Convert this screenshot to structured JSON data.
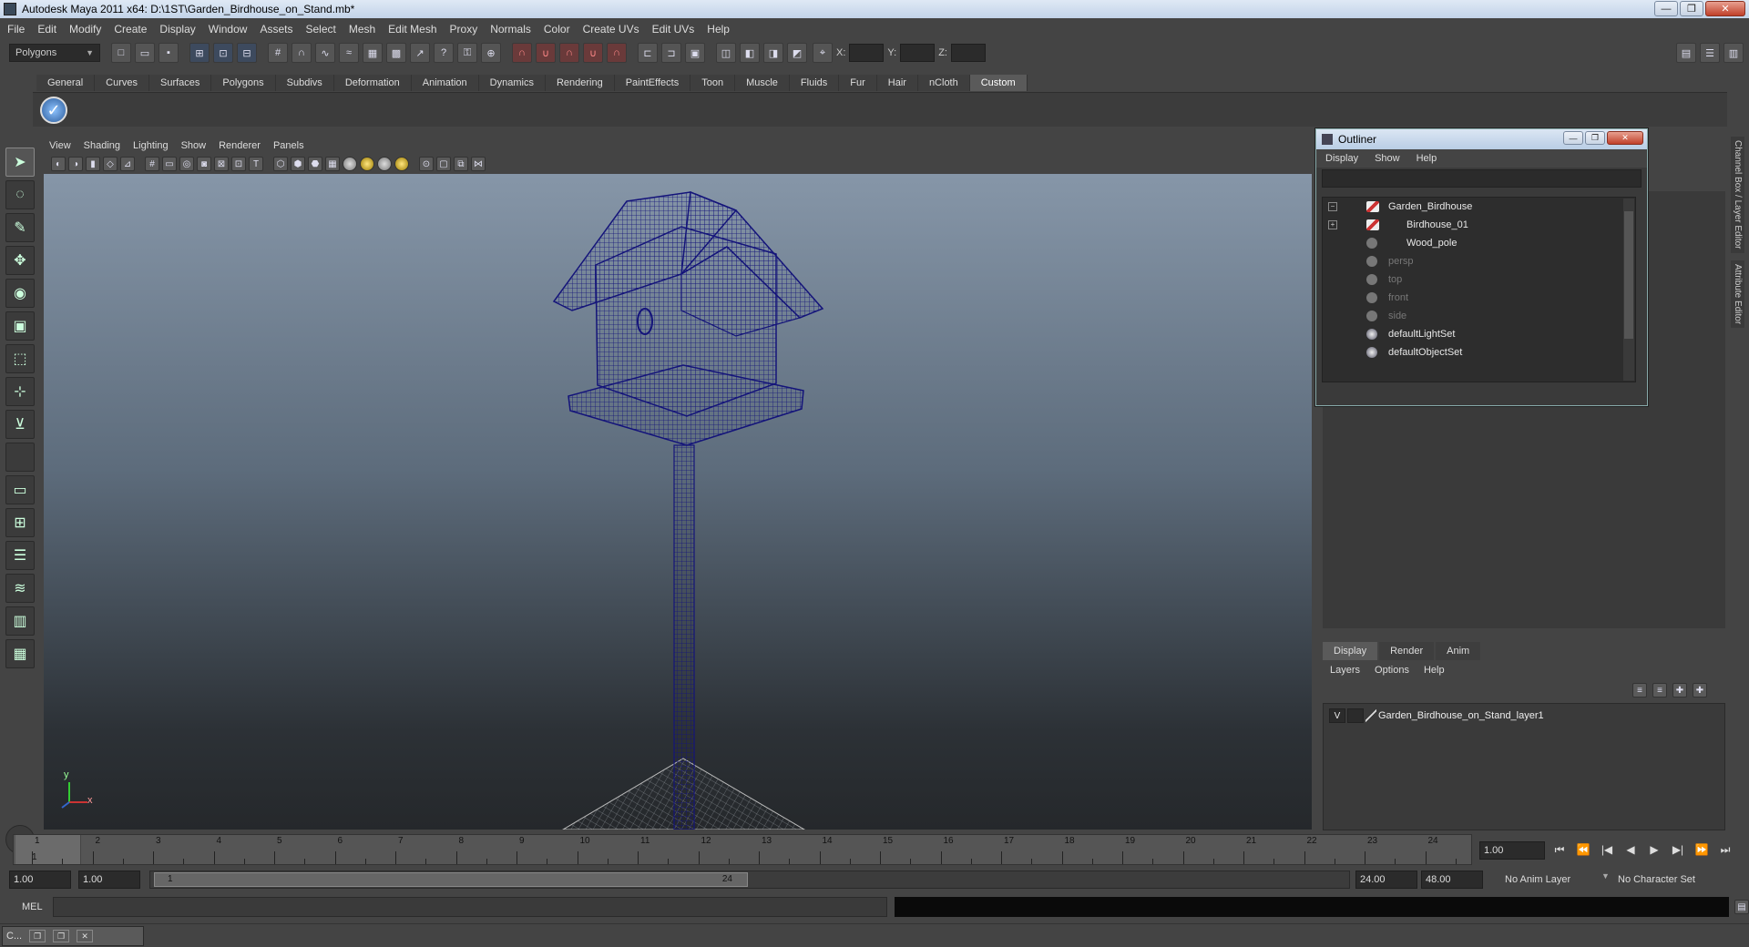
{
  "window": {
    "title": "Autodesk Maya 2011 x64: D:\\1ST\\Garden_Birdhouse_on_Stand.mb*",
    "btn_min": "—",
    "btn_max": "❐",
    "btn_close": "✕"
  },
  "menubar": {
    "items": [
      "File",
      "Edit",
      "Modify",
      "Create",
      "Display",
      "Window",
      "Assets",
      "Select",
      "Mesh",
      "Edit Mesh",
      "Proxy",
      "Normals",
      "Color",
      "Create UVs",
      "Edit UVs",
      "Help"
    ]
  },
  "status": {
    "mode": "Polygons",
    "x_label": "X:",
    "y_label": "Y:",
    "z_label": "Z:"
  },
  "shelf": {
    "tabs": [
      "General",
      "Curves",
      "Surfaces",
      "Polygons",
      "Subdivs",
      "Deformation",
      "Animation",
      "Dynamics",
      "Rendering",
      "PaintEffects",
      "Toon",
      "Muscle",
      "Fluids",
      "Fur",
      "Hair",
      "nCloth",
      "Custom"
    ],
    "active_tab": "Custom"
  },
  "viewport": {
    "menu": [
      "View",
      "Shading",
      "Lighting",
      "Show",
      "Renderer",
      "Panels"
    ],
    "axis_x": "x",
    "axis_y": "y",
    "wire_color": "#14147a"
  },
  "outliner": {
    "title": "Outliner",
    "menu": [
      "Display",
      "Show",
      "Help"
    ],
    "items": [
      {
        "name": "Garden_Birdhouse",
        "type": "mesh",
        "expander": "−",
        "dim": false
      },
      {
        "name": "Birdhouse_01",
        "type": "mesh",
        "expander": "+",
        "dim": false
      },
      {
        "name": "Wood_pole",
        "type": "mesh",
        "expander": "",
        "dim": false
      },
      {
        "name": "persp",
        "type": "camera",
        "expander": "",
        "dim": true
      },
      {
        "name": "top",
        "type": "camera",
        "expander": "",
        "dim": true
      },
      {
        "name": "front",
        "type": "camera",
        "expander": "",
        "dim": true
      },
      {
        "name": "side",
        "type": "camera",
        "expander": "",
        "dim": true
      },
      {
        "name": "defaultLightSet",
        "type": "set",
        "expander": "",
        "dim": false
      },
      {
        "name": "defaultObjectSet",
        "type": "set",
        "expander": "",
        "dim": false
      }
    ]
  },
  "side_tabs": [
    "Channel Box / Layer Editor",
    "Attribute Editor"
  ],
  "layers": {
    "tabs": [
      "Display",
      "Render",
      "Anim"
    ],
    "active_tab": "Display",
    "menu": [
      "Layers",
      "Options",
      "Help"
    ],
    "rows": [
      {
        "visible": "V",
        "name": "Garden_Birdhouse_on_Stand_layer1"
      }
    ]
  },
  "timeline": {
    "frames": [
      "1",
      "2",
      "3",
      "4",
      "5",
      "6",
      "7",
      "8",
      "9",
      "10",
      "11",
      "12",
      "13",
      "14",
      "15",
      "16",
      "17",
      "18",
      "19",
      "20",
      "21",
      "22",
      "23",
      "24"
    ],
    "current_frame_label": "1",
    "current_time": "1.00",
    "playback": [
      "⏮",
      "⏪",
      "|◀",
      "◀",
      "▶",
      "▶|",
      "⏩",
      "⏭"
    ]
  },
  "range": {
    "start": "1.00",
    "playback_start": "1.00",
    "thumb_start": "1",
    "thumb_end": "24",
    "playback_end": "24.00",
    "end": "48.00",
    "anim_layer": "No Anim Layer",
    "character_set": "No Character Set"
  },
  "cmdline": {
    "label": "MEL"
  },
  "taskbar": {
    "item_label": "C..."
  }
}
